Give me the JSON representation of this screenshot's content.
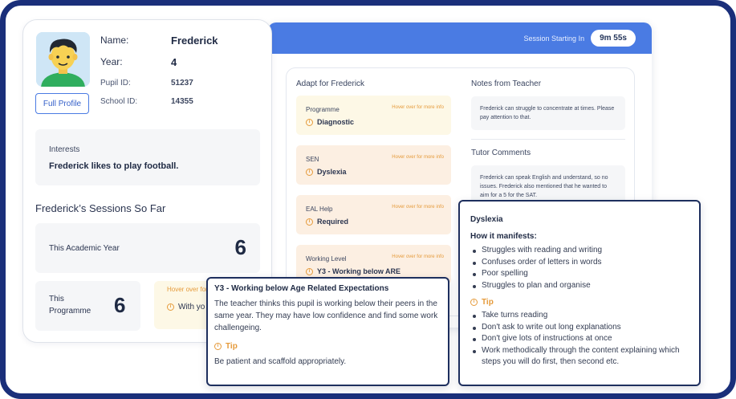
{
  "session": {
    "label": "Session Starting In",
    "timer": "9m 55s"
  },
  "adapt": {
    "title": "Adapt for Frederick",
    "hover_text": "Hover over for more info",
    "cards": [
      {
        "category": "Programme",
        "value": "Diagnostic"
      },
      {
        "category": "SEN",
        "value": "Dyslexia"
      },
      {
        "category": "EAL Help",
        "value": "Required"
      },
      {
        "category": "Working Level",
        "value": "Y3 - Working below ARE"
      }
    ]
  },
  "notes": {
    "teacher_title": "Notes from Teacher",
    "teacher_text": "Frederick can struggle to concentrate at times. Please pay attention to that.",
    "tutor_title": "Tutor Comments",
    "tutor_text": "Frederick can speak English and understand, so no issues. Frederick also mentioned that he wanted to aim for a 5 for the SAT."
  },
  "profile": {
    "name_label": "Name:",
    "name": "Frederick",
    "year_label": "Year:",
    "year": "4",
    "pupil_id_label": "Pupil ID:",
    "pupil_id": "51237",
    "school_id_label": "School ID:",
    "school_id": "14355",
    "full_profile_button": "Full Profile",
    "interests_title": "Interests",
    "interests_text": "Frederick likes to play football.",
    "sessions_title": "Frederick’s Sessions So Far",
    "academic_year_label": "This Academic Year",
    "academic_year_count": "6",
    "programme_label_1": "This",
    "programme_label_2": "Programme",
    "programme_count": "6",
    "partial_hover": "Hover over for",
    "partial_text": "With yo"
  },
  "working_popover": {
    "title": "Y3 - Working below Age Related Expectations",
    "text": "The teacher thinks this pupil is working below their peers in the same year. They may have low confidence and find some work challengeing.",
    "tip_label": "Tip",
    "tip_text": "Be patient and scaffold appropriately."
  },
  "dyslexia_popover": {
    "title": "Dyslexia",
    "manifests_title": "How it manifests:",
    "manifests": [
      "Struggles with reading and writing",
      "Confuses order of letters in words",
      "Poor spelling",
      "Struggles to plan and organise"
    ],
    "tip_label": "Tip",
    "tips": [
      "Take turns reading",
      "Don't ask to write out long explanations",
      "Don't give lots of instructions at once",
      "Work methodically through the content explaining which steps you will do first, then second etc."
    ]
  },
  "icons": {
    "info": "info-circle-icon"
  },
  "colors": {
    "frame": "#1a2f7a",
    "accent_blue": "#4a7be3",
    "tip_orange": "#e59a3a"
  }
}
